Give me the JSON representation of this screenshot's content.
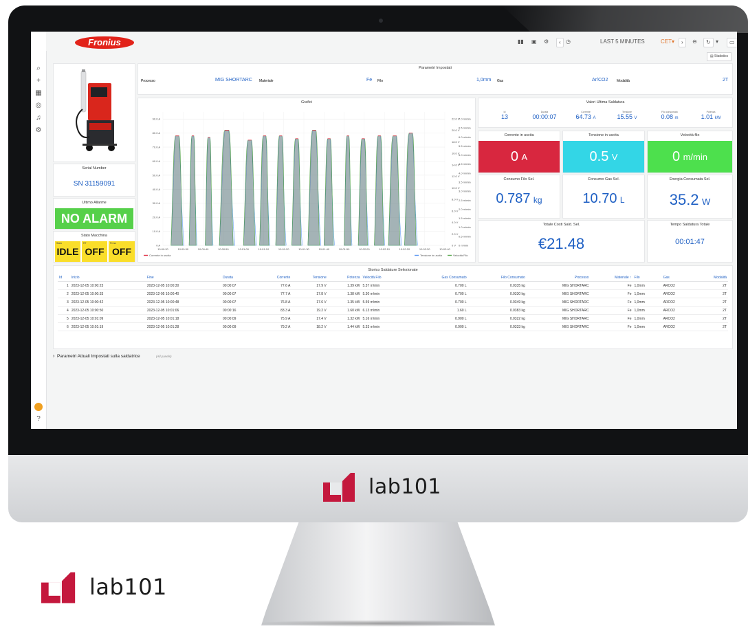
{
  "brand": {
    "name": "lab101"
  },
  "app": {
    "logo": "Fronius"
  },
  "toolbar": {
    "time_range": "LAST 5 MINUTES",
    "timezone": "CET",
    "statistics_label": "Statistics"
  },
  "sidebar": {
    "icons": [
      "search-icon",
      "plus-icon",
      "grid-icon",
      "compass-icon",
      "bell-icon",
      "gear-icon"
    ]
  },
  "serial": {
    "title": "Serial Number",
    "value": "SN 31159091"
  },
  "alarm": {
    "title": "Ultimo Allarme",
    "value": "NO ALARM",
    "color": "#56d04a"
  },
  "stato": {
    "title": "Stato Macchina",
    "cells": [
      {
        "mini": "Stato",
        "value": "IDLE"
      },
      {
        "mini": "RT",
        "value": "OFF"
      },
      {
        "mini": "Press",
        "value": "OFF"
      }
    ],
    "color": "#fade2a"
  },
  "parametri": {
    "title": "Parametri Impostati",
    "processo_label": "Processo",
    "processo_value": "MIG SHORTARC",
    "materiale_label": "Materiale",
    "materiale_value": "Fe",
    "filo_label": "Filo",
    "filo_value": "1,0mm",
    "gas_label": "Gas",
    "gas_value": "Ar/CO2",
    "modalita_label": "Modalità",
    "modalita_value": "2T"
  },
  "grafici": {
    "title": "Grafici"
  },
  "chart_data": {
    "type": "area",
    "title": "Grafici",
    "x": [
      "10:00:20",
      "10:00:30",
      "10:00:40",
      "10:00:50",
      "10:01:00",
      "10:01:10",
      "10:01:20",
      "10:01:30",
      "10:01:40",
      "10:01:50",
      "10:02:00",
      "10:02:10",
      "10:02:20",
      "10:02:30",
      "10:02:40"
    ],
    "y_left_ticks": [
      "0 A",
      "10.0 A",
      "20.0 A",
      "30.0 A",
      "40.0 A",
      "50.0 A",
      "60.0 A",
      "70.0 A",
      "80.0 A",
      "90.0 A"
    ],
    "y_right_voltage_ticks": [
      "0 V",
      "2.0 V",
      "4.0 V",
      "6.0 V",
      "8.0 V",
      "10.0 V",
      "12.0 V",
      "14.0 V",
      "16.0 V",
      "18.0 V",
      "20.0 V",
      "22.0 V"
    ],
    "y_right_speed_ticks": [
      "0 m/min",
      "0.5 m/min",
      "1.0 m/min",
      "1.5 m/min",
      "2.0 m/min",
      "2.5 m/min",
      "3.0 m/min",
      "3.5 m/min",
      "4.0 m/min",
      "4.5 m/min",
      "5.0 m/min",
      "5.5 m/min",
      "6.0 m/min",
      "6.5 m/min",
      "7.0 m/min"
    ],
    "ylim_left": [
      0,
      95
    ],
    "peaks": [
      {
        "start": "10:00:24",
        "end": "10:00:29",
        "current": 78
      },
      {
        "start": "10:00:33",
        "end": "10:00:36",
        "current": 78
      },
      {
        "start": "10:00:41",
        "end": "10:00:44",
        "current": 77
      },
      {
        "start": "10:00:48",
        "end": "10:00:54",
        "current": 82
      },
      {
        "start": "10:01:00",
        "end": "10:01:05",
        "current": 75
      },
      {
        "start": "10:01:08",
        "end": "10:01:12",
        "current": 78
      },
      {
        "start": "10:01:16",
        "end": "10:01:20",
        "current": 78
      },
      {
        "start": "10:01:24",
        "end": "10:01:28",
        "current": 76
      },
      {
        "start": "10:01:32",
        "end": "10:01:37",
        "current": 82
      },
      {
        "start": "10:01:40",
        "end": "10:01:44",
        "current": 76
      },
      {
        "start": "10:01:50",
        "end": "10:01:53",
        "current": 78
      },
      {
        "start": "10:01:57",
        "end": "10:02:01",
        "current": 76
      },
      {
        "start": "10:02:05",
        "end": "10:02:09",
        "current": 78
      },
      {
        "start": "10:02:12",
        "end": "10:02:17",
        "current": 78
      },
      {
        "start": "10:02:20",
        "end": "10:02:25",
        "current": 80
      }
    ],
    "series": [
      {
        "name": "Corrente in uscita",
        "color": "#e02f44"
      },
      {
        "name": "Tensione in uscita",
        "color": "#5794f2"
      },
      {
        "name": "Velocità Filo",
        "color": "#56a64b"
      }
    ]
  },
  "valori": {
    "title": "Valori Ultima Saldatura",
    "cols": [
      {
        "label": "Id",
        "value": "13",
        "unit": ""
      },
      {
        "label": "Durata",
        "value": "00:00:07",
        "unit": ""
      },
      {
        "label": "Corrente",
        "value": "64.73",
        "unit": "A"
      },
      {
        "label": "Tensione",
        "value": "15.55",
        "unit": "V"
      },
      {
        "label": "Filo consumato",
        "value": "0.08",
        "unit": "m"
      },
      {
        "label": "Potenza",
        "value": "1.01",
        "unit": "kW"
      }
    ]
  },
  "stat_boxes": [
    {
      "title": "Corrente in uscita",
      "value": "0",
      "unit": "A",
      "color": "#d8273f"
    },
    {
      "title": "Tensione in uscita",
      "value": "0.5",
      "unit": "V",
      "color": "#33d6e6"
    },
    {
      "title": "Velocità filo",
      "value": "0",
      "unit": "m/min",
      "color": "#4de04d"
    }
  ],
  "consumi": [
    {
      "title": "Consumo Filo Sel.",
      "value": "0.787",
      "unit": "kg"
    },
    {
      "title": "Consumo Gas Sel.",
      "value": "10.70",
      "unit": "L"
    },
    {
      "title": "Energia Consumata Sel.",
      "value": "35.2",
      "unit": "W"
    }
  ],
  "totale_costi": {
    "title": "Totale Costi Sald. Sel.",
    "value": "€21.48"
  },
  "tempo": {
    "title": "Tempo Saldatura Totale",
    "value": "00:01:47"
  },
  "storico": {
    "title": "Storico Saldature Selezionate",
    "headers": [
      "Id",
      "Inizio",
      "Fine",
      "Durata",
      "Corrente",
      "Tensione",
      "Potenza",
      "Velocità Filo",
      "Gas Consumato",
      "Filo Consumato",
      "Processo",
      "Materiale ↑",
      "Filo",
      "Gas",
      "Modalità"
    ],
    "rows": [
      [
        "1",
        "2023-12-05 10:00:23",
        "2023-12-05 10:00:30",
        "00:00:07",
        "77.6 A",
        "17.9 V",
        "1.39 kW",
        "5.37 m/min",
        "0.700 L",
        "0.0335 kg",
        "MIG SHORTARC",
        "Fe",
        "1,0mm",
        "ARCO2",
        "2T"
      ],
      [
        "2",
        "2023-12-05 10:00:33",
        "2023-12-05 10:00:40",
        "00:00:07",
        "77.7 A",
        "17.8 V",
        "1.38 kW",
        "5.30 m/min",
        "0.700 L",
        "0.0330 kg",
        "MIG SHORTARC",
        "Fe",
        "1,0mm",
        "ARCO2",
        "2T"
      ],
      [
        "3",
        "2023-12-05 10:00:42",
        "2023-12-05 10:00:48",
        "00:00:07",
        "76.8 A",
        "17.6 V",
        "1.35 kW",
        "5.59 m/min",
        "0.700 L",
        "0.0349 kg",
        "MIG SHORTARC",
        "Fe",
        "1,0mm",
        "ARCO2",
        "2T"
      ],
      [
        "4",
        "2023-12-05 10:00:50",
        "2023-12-05 10:01:06",
        "00:00:16",
        "83.3 A",
        "19.2 V",
        "1.60 kW",
        "6.13 m/min",
        "1.60 L",
        "0.0383 kg",
        "MIG SHORTARC",
        "Fe",
        "1,0mm",
        "ARCO2",
        "2T"
      ],
      [
        "5",
        "2023-12-05 10:01:09",
        "2023-12-05 10:01:18",
        "00:00:09",
        "75.9 A",
        "17.4 V",
        "1.32 kW",
        "5.16 m/min",
        "0.900 L",
        "0.0322 kg",
        "MIG SHORTARC",
        "Fe",
        "1,0mm",
        "ARCO2",
        "2T"
      ],
      [
        "6",
        "2023-12-05 10:01:19",
        "2023-12-05 10:01:28",
        "00:00:09",
        "79.2 A",
        "18.2 V",
        "1.44 kW",
        "5.33 m/min",
        "0.900 L",
        "0.0333 kg",
        "MIG SHORTARC",
        "Fe",
        "1,0mm",
        "ARCO2",
        "2T"
      ]
    ]
  },
  "collapsed_row": {
    "title": "Parametri Attuali Impostati sulla saldatrice",
    "sub": "(All panels)"
  }
}
